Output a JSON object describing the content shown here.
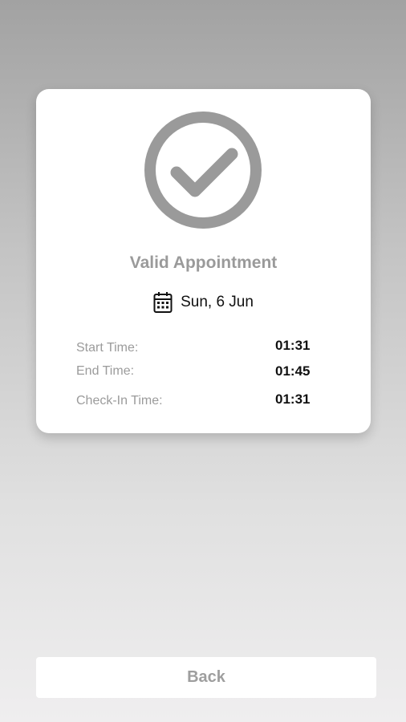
{
  "card": {
    "status_icon": "check-circle-icon",
    "title": "Valid Appointment",
    "date_icon": "calendar-icon",
    "date": "Sun, 6 Jun",
    "details": [
      {
        "label": "Start Time:",
        "value": "01:31"
      },
      {
        "label": "End Time:",
        "value": "01:45"
      },
      {
        "label": "Check-In Time:",
        "value": "01:31"
      }
    ]
  },
  "footer": {
    "back_label": "Back"
  },
  "colors": {
    "icon_gray": "#9a9a9a",
    "label_gray": "#9b9b9b",
    "value_text": "#111111"
  }
}
